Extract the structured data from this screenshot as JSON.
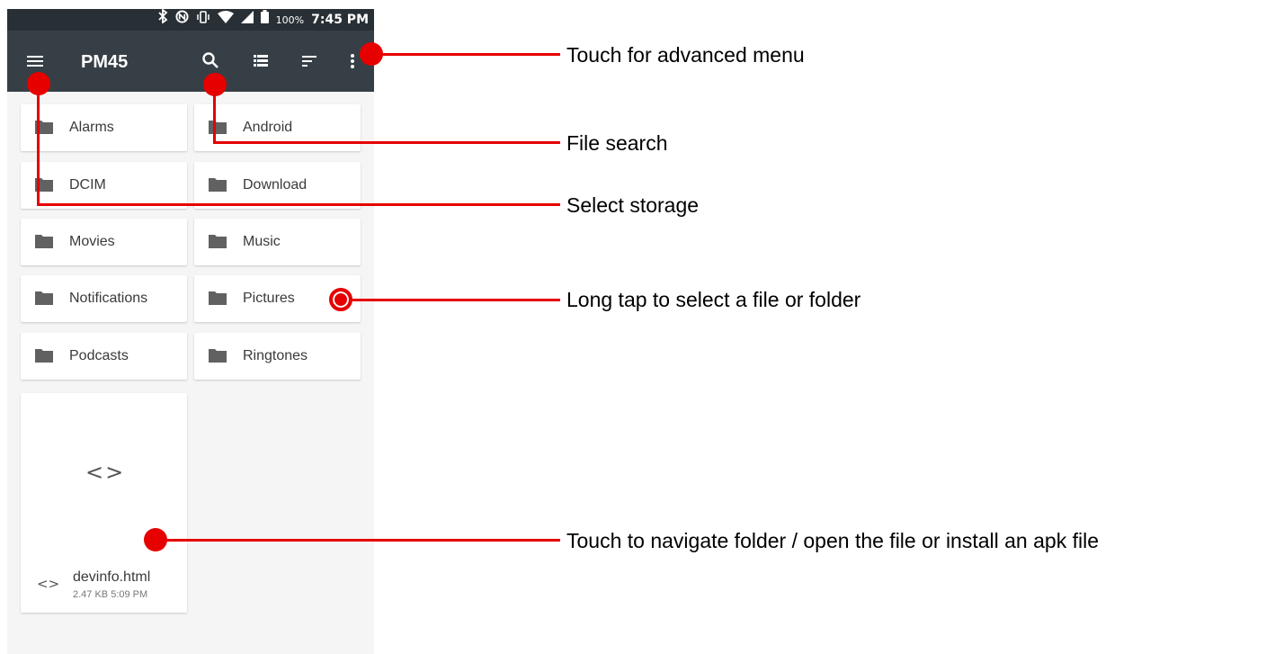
{
  "status_bar": {
    "icons": [
      "bluetooth-icon",
      "nfc-icon",
      "vibrate-icon",
      "wifi-icon",
      "signal-icon",
      "battery-icon"
    ],
    "battery": "100%",
    "time": "7:45 PM"
  },
  "app_bar": {
    "title": "PM45",
    "icons": [
      "menu-icon",
      "search-icon",
      "list-view-icon",
      "sort-icon",
      "more-vert-icon"
    ]
  },
  "folders": [
    {
      "label": "Alarms"
    },
    {
      "label": "Android"
    },
    {
      "label": "DCIM"
    },
    {
      "label": "Download"
    },
    {
      "label": "Movies"
    },
    {
      "label": "Music"
    },
    {
      "label": "Notifications"
    },
    {
      "label": "Pictures"
    },
    {
      "label": "Podcasts"
    },
    {
      "label": "Ringtones"
    }
  ],
  "file": {
    "name": "devinfo.html",
    "meta": "2.47 KB 5:09 PM",
    "icon": "code-icon"
  },
  "callouts": {
    "advanced_menu": "Touch for advanced menu",
    "file_search": "File search",
    "select_storage": "Select storage",
    "long_tap": "Long tap to select a file or folder",
    "navigate": "Touch to navigate folder / open the file or install an apk file"
  },
  "colors": {
    "status_bar": "#283035",
    "app_bar": "#363f45",
    "annotation_red": "#e60000",
    "background": "#f5f5f5"
  }
}
